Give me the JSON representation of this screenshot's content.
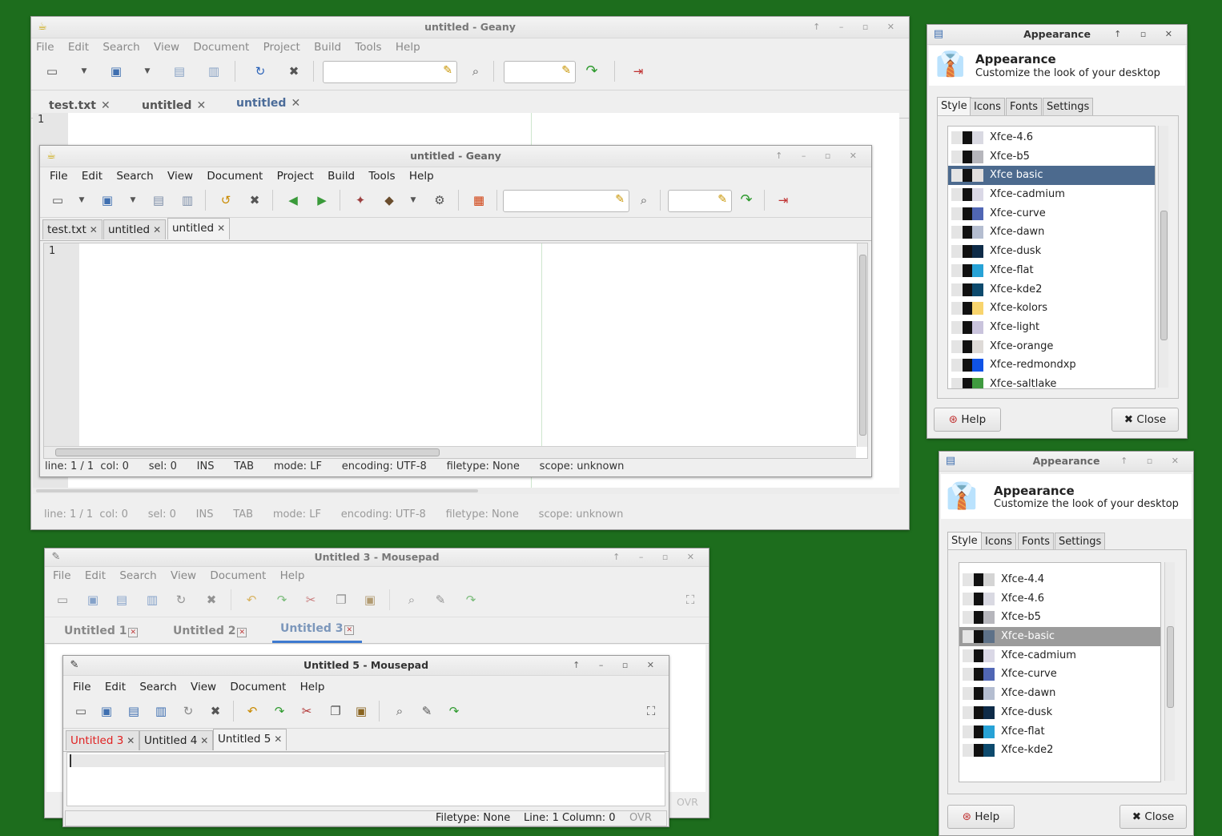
{
  "desktop_bg": "#1d6d1d",
  "geany_back": {
    "title": "untitled - Geany",
    "menu": [
      "File",
      "Edit",
      "Search",
      "View",
      "Document",
      "Project",
      "Build",
      "Tools",
      "Help"
    ],
    "tabs": [
      "test.txt",
      "untitled",
      "untitled"
    ],
    "tab_close": "✕",
    "line_number": "1",
    "status": "line: 1 / 1  col: 0      sel: 0      INS      TAB      mode: LF      encoding: UTF-8      filetype: None      scope: unknown"
  },
  "geany_front": {
    "title": "untitled - Geany",
    "menu": [
      "File",
      "Edit",
      "Search",
      "View",
      "Document",
      "Project",
      "Build",
      "Tools",
      "Help"
    ],
    "tabs": [
      "test.txt",
      "untitled",
      "untitled"
    ],
    "tab_close": "✕",
    "line_number": "1",
    "status": "line: 1 / 1  col: 0      sel: 0      INS      TAB      mode: LF      encoding: UTF-8      filetype: None      scope: unknown"
  },
  "mousepad_back": {
    "title": "Untitled 3 - Mousepad",
    "menu": [
      "File",
      "Edit",
      "Search",
      "View",
      "Document",
      "Help"
    ],
    "tabs": [
      "Untitled 1",
      "Untitled 2",
      "Untitled 3"
    ],
    "tab_close": "✕",
    "ovr": "OVR"
  },
  "mousepad_front": {
    "title": "Untitled 5 - Mousepad",
    "menu": [
      "File",
      "Edit",
      "Search",
      "View",
      "Document",
      "Help"
    ],
    "tabs": [
      "Untitled 3",
      "Untitled 4",
      "Untitled 5"
    ],
    "tab_close": "✕",
    "filetype": "Filetype: None",
    "position": "Line: 1 Column: 0",
    "ovr": "OVR"
  },
  "appearance_top": {
    "title": "Appearance",
    "heading": "Appearance",
    "subtitle": "Customize the look of your desktop",
    "tabs": [
      "Style",
      "Icons",
      "Fonts",
      "Settings"
    ],
    "themes": [
      "Xfce-4.6",
      "Xfce-b5",
      "Xfce basic",
      "Xfce-cadmium",
      "Xfce-curve",
      "Xfce-dawn",
      "Xfce-dusk",
      "Xfce-flat",
      "Xfce-kde2",
      "Xfce-kolors",
      "Xfce-light",
      "Xfce-orange",
      "Xfce-redmondxp",
      "Xfce-saltlake"
    ],
    "swatch_colors": [
      "#d9d9e2",
      "#b6b6bc",
      "#e1dedd",
      "#dad8e6",
      "#5066b4",
      "#b4bdd0",
      "#0e2b48",
      "#27a2d6",
      "#0d4a6d",
      "#f8d46d",
      "#c9c3dc",
      "#dedad7",
      "#1053e6",
      "#3f9a3f"
    ],
    "help": "Help",
    "close": "Close"
  },
  "appearance_bottom": {
    "title": "Appearance",
    "heading": "Appearance",
    "subtitle": "Customize the look of your desktop",
    "tabs": [
      "Style",
      "Icons",
      "Fonts",
      "Settings"
    ],
    "themes": [
      "Xfce-4.4",
      "Xfce-4.6",
      "Xfce-b5",
      "Xfce-basic",
      "Xfce-cadmium",
      "Xfce-curve",
      "Xfce-dawn",
      "Xfce-dusk",
      "Xfce-flat",
      "Xfce-kde2"
    ],
    "swatch_colors": [
      "#d4d4d4",
      "#d9d9e2",
      "#b6b6bc",
      "#5d7188",
      "#dad8e6",
      "#5066b4",
      "#b4bdd0",
      "#0e2b48",
      "#27a2d6",
      "#0d4a6d"
    ],
    "help": "Help",
    "close": "Close"
  }
}
